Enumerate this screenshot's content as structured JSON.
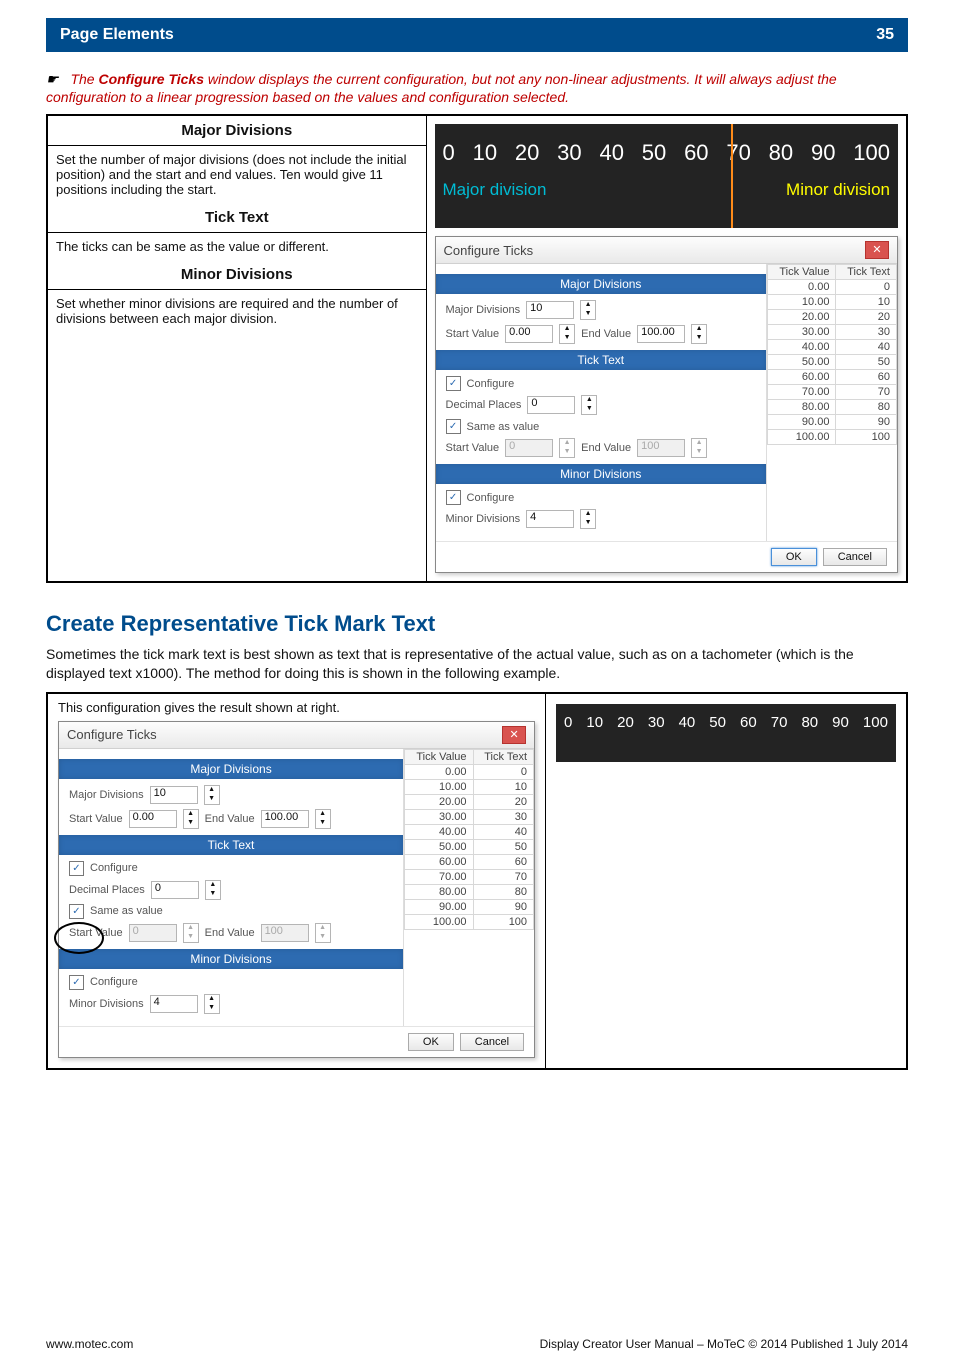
{
  "header": {
    "title": "Page Elements",
    "page_no": "35"
  },
  "note": {
    "lead": "Configure Ticks",
    "prefix": "The ",
    "rest": " window displays the current configuration, but not any non-linear adjustments. It will always adjust the configuration to a linear progression based on the values and configuration selected."
  },
  "left_cells": {
    "major_head": "Major Divisions",
    "major_body": "Set the number of major divisions (does not include the initial position) and the start and end values. Ten would give 11 positions including the start.",
    "tick_head": "Tick Text",
    "tick_body": "The ticks can be same as the value or different.",
    "minor_head": "Minor Divisions",
    "minor_body": "Set whether minor divisions are required and the number of divisions between each major division."
  },
  "gauge": {
    "numbers": [
      "0",
      "10",
      "20",
      "30",
      "40",
      "50",
      "60",
      "70",
      "80",
      "90",
      "100"
    ],
    "major_label": "Major division",
    "minor_label": "Minor division"
  },
  "dlg1": {
    "title": "Configure Ticks",
    "sec_major": "Major Divisions",
    "major_div_label": "Major Divisions",
    "major_div_val": "10",
    "start_label": "Start Value",
    "start_val": "0.00",
    "end_label": "End Value",
    "end_val": "100.00",
    "sec_tick": "Tick Text",
    "cfg_label": "Configure",
    "dp_label": "Decimal Places",
    "dp_val": "0",
    "sav_label": "Same as value",
    "sv_label": "Start Value",
    "sv_val": "0",
    "ev_label": "End Value",
    "ev_val": "100",
    "sec_minor": "Minor Divisions",
    "cfg2_label": "Configure",
    "minor_div_label": "Minor Divisions",
    "minor_div_val": "4",
    "tv_head1": "Tick Value",
    "tv_head2": "Tick Text",
    "rows": [
      {
        "v": "0.00",
        "t": "0"
      },
      {
        "v": "10.00",
        "t": "10"
      },
      {
        "v": "20.00",
        "t": "20"
      },
      {
        "v": "30.00",
        "t": "30"
      },
      {
        "v": "40.00",
        "t": "40"
      },
      {
        "v": "50.00",
        "t": "50"
      },
      {
        "v": "60.00",
        "t": "60"
      },
      {
        "v": "70.00",
        "t": "70"
      },
      {
        "v": "80.00",
        "t": "80"
      },
      {
        "v": "90.00",
        "t": "90"
      },
      {
        "v": "100.00",
        "t": "100"
      }
    ],
    "ok": "OK",
    "cancel": "Cancel"
  },
  "section2": {
    "heading": "Create Representative Tick Mark Text",
    "para": "Sometimes the tick mark text is best shown as text that is representative of the actual value, such as on a tachometer (which is the displayed text x1000). The method for doing this is shown in the following example.",
    "caption": "This configuration gives the result shown at right.",
    "gauge_numbers": [
      "0",
      "10",
      "20",
      "30",
      "40",
      "50",
      "60",
      "70",
      "80",
      "90",
      "100"
    ]
  },
  "footer": {
    "left": "www.motec.com",
    "right": "Display Creator User Manual – MoTeC © 2014 Published 1 July 2014"
  }
}
